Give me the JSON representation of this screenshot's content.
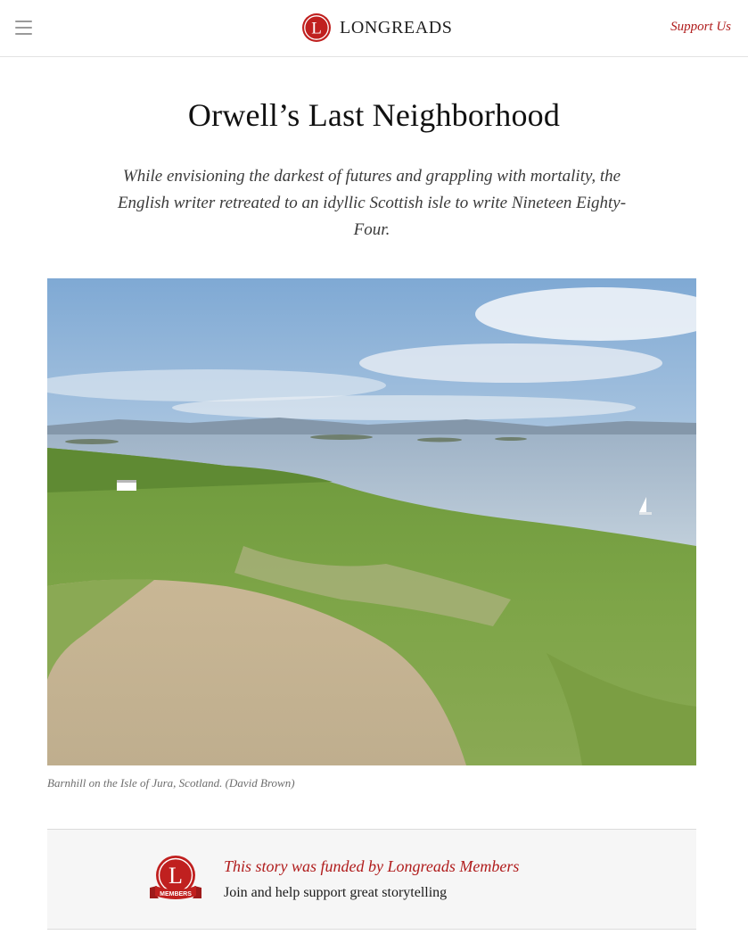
{
  "header": {
    "menu_icon": "hamburger-menu-icon",
    "brand_letter": "L",
    "brand_name": "LONGREADS",
    "support_label": "Support Us"
  },
  "article": {
    "title": "Orwell’s Last Neighborhood",
    "dek": "While envisioning the darkest of futures and grappling with mortality, the English writer retreated to an idyllic Scottish isle to write Nineteen Eighty-Four.",
    "caption": "Barnhill on the Isle of Jura, Scotland. (David Brown)"
  },
  "members": {
    "badge_letter": "L",
    "badge_ribbon": "MEMBERS",
    "headline": "This story was funded by Longreads Members",
    "subline": "Join and help support great storytelling"
  },
  "colors": {
    "brand_red": "#b01c1c",
    "text": "#1a1a1a",
    "muted": "#6d6d6d"
  }
}
